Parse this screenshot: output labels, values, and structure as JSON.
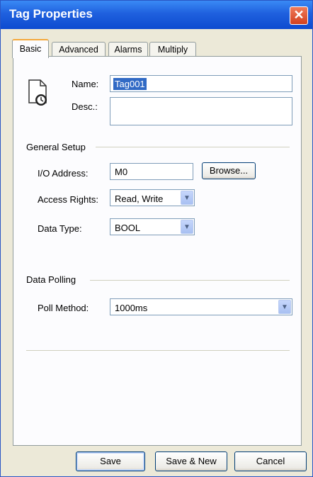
{
  "window": {
    "title": "Tag Properties",
    "close_glyph": "✕",
    "close_icon": "close-icon"
  },
  "tabs": [
    {
      "label": "Basic",
      "active": true
    },
    {
      "label": "Advanced",
      "active": false
    },
    {
      "label": "Alarms",
      "active": false
    },
    {
      "label": "Multiply",
      "active": false
    }
  ],
  "basic": {
    "tag_icon": "tag-document-icon",
    "name_label": "Name:",
    "name_value": "Tag001",
    "desc_label": "Desc.:",
    "desc_value": ""
  },
  "general_setup": {
    "heading": "General Setup",
    "io_address_label": "I/O Address:",
    "io_address_value": "M0",
    "browse_label": "Browse...",
    "access_rights_label": "Access Rights:",
    "access_rights_value": "Read, Write",
    "data_type_label": "Data Type:",
    "data_type_value": "BOOL"
  },
  "data_polling": {
    "heading": "Data Polling",
    "poll_method_label": "Poll Method:",
    "poll_method_value": "1000ms"
  },
  "dropdown_glyph": "▼",
  "buttons": {
    "save": "Save",
    "save_new": "Save & New",
    "cancel": "Cancel"
  },
  "colors": {
    "titlebar": "#1f60de",
    "selection": "#316ac5",
    "tab_accent": "#f5a83b"
  }
}
